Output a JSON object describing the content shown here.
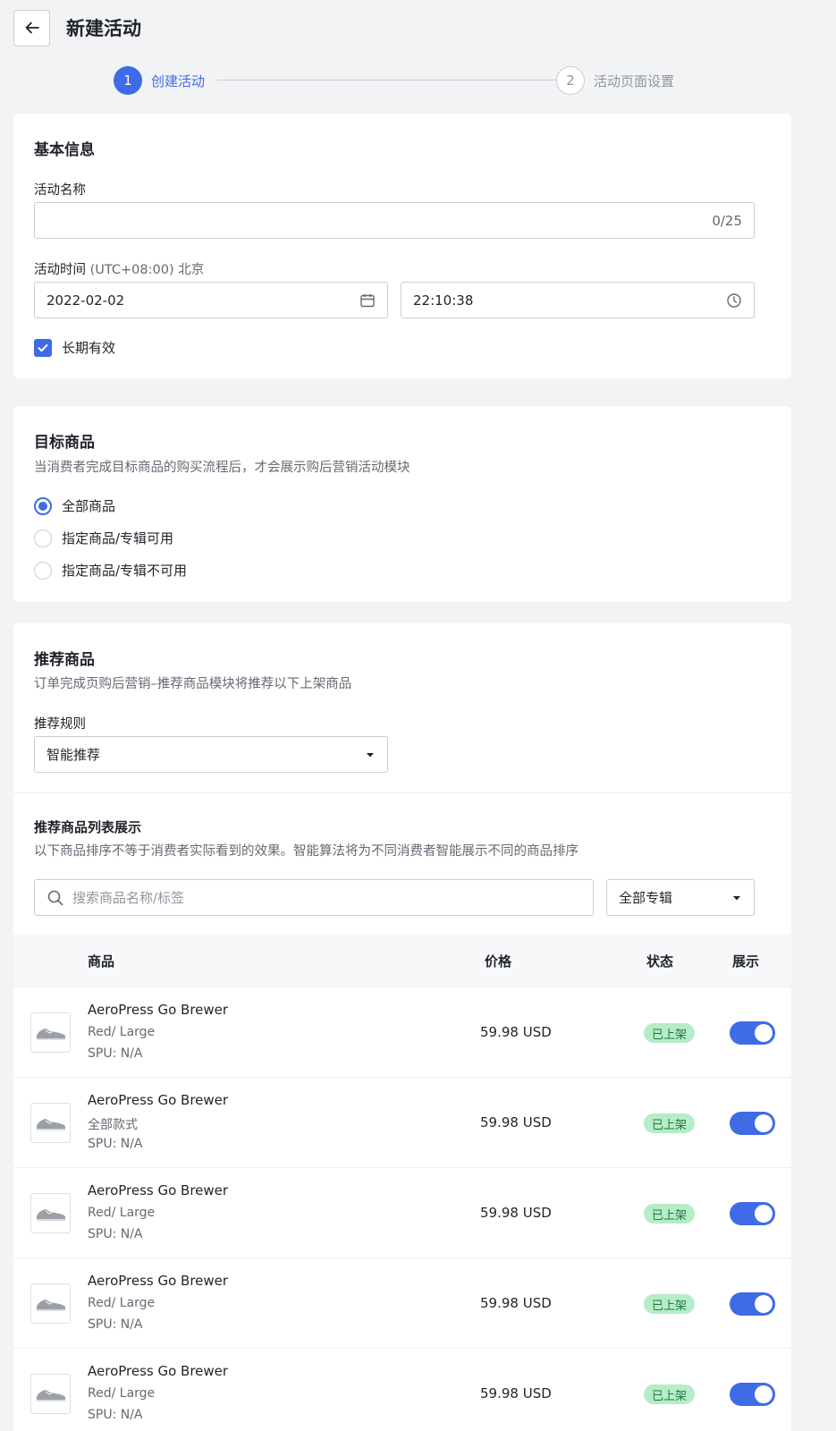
{
  "header": {
    "title": "新建活动"
  },
  "steps": [
    {
      "index": "1",
      "label": "创建活动",
      "state": "active"
    },
    {
      "index": "2",
      "label": "活动页面设置",
      "state": "pending"
    }
  ],
  "basic_info": {
    "title": "基本信息",
    "name_label": "活动名称",
    "name_value": "",
    "name_counter": "0/25",
    "time_label": "活动时间",
    "time_zone": "(UTC+08:00) 北京",
    "date_value": "2022-02-02",
    "time_value": "22:10:38",
    "long_term_label": "长期有效",
    "long_term_checked": true
  },
  "target_products": {
    "title": "目标商品",
    "description": "当消费者完成目标商品的购买流程后，才会展示购后营销活动模块",
    "options": [
      {
        "label": "全部商品",
        "checked": true
      },
      {
        "label": "指定商品/专辑可用",
        "checked": false
      },
      {
        "label": "指定商品/专辑不可用",
        "checked": false
      }
    ]
  },
  "recommended": {
    "title": "推荐商品",
    "description": "订单完成页购后营销–推荐商品模块将推荐以下上架商品",
    "rule_label": "推荐规则",
    "rule_value": "智能推荐",
    "list_title": "推荐商品列表展示",
    "list_description": "以下商品排序不等于消费者实际看到的效果。智能算法将为不同消费者智能展示不同的商品排序",
    "search_placeholder": "搜索商品名称/标签",
    "collection_value": "全部专辑",
    "columns": {
      "product": "商品",
      "price": "价格",
      "status": "状态",
      "display": "展示"
    },
    "rows": [
      {
        "name": "AeroPress Go Brewer",
        "variant": "Red/ Large",
        "spu": "SPU: N/A",
        "price": "59.98 USD",
        "status": "已上架",
        "display_on": true
      },
      {
        "name": "AeroPress Go Brewer",
        "variant": "全部款式",
        "spu": "SPU: N/A",
        "price": "59.98 USD",
        "status": "已上架",
        "display_on": true
      },
      {
        "name": "AeroPress Go Brewer",
        "variant": "Red/ Large",
        "spu": "SPU: N/A",
        "price": "59.98 USD",
        "status": "已上架",
        "display_on": true
      },
      {
        "name": "AeroPress Go Brewer",
        "variant": "Red/ Large",
        "spu": "SPU: N/A",
        "price": "59.98 USD",
        "status": "已上架",
        "display_on": true
      },
      {
        "name": "AeroPress Go Brewer",
        "variant": "Red/ Large",
        "spu": "SPU: N/A",
        "price": "59.98 USD",
        "status": "已上架",
        "display_on": true
      }
    ]
  },
  "icons": [
    "arrow-left-icon",
    "calendar-icon",
    "clock-icon",
    "check-icon",
    "caret-down-icon",
    "search-icon",
    "shoe-thumbnail-icon"
  ],
  "colors": {
    "primary": "#3f6be6",
    "badge_bg": "#b6ecc8",
    "badge_text": "#1e7a3d",
    "page_bg": "#f2f3f5"
  }
}
